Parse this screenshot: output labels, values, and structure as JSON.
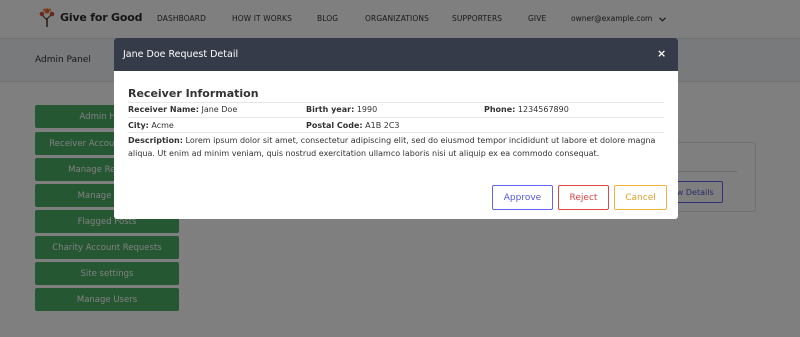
{
  "brand": {
    "name": "Give for Good",
    "logo_icon": "tree-heart-icon"
  },
  "nav": {
    "items": [
      "DASHBOARD",
      "HOW IT WORKS",
      "BLOG",
      "ORGANIZATIONS",
      "SUPPORTERS",
      "GIVE"
    ],
    "user_email": "owner@example.com"
  },
  "admin_panel_title": "Admin Panel",
  "sidebar": {
    "items": [
      "Admin Home",
      "Receiver Account Requests",
      "Manage Receivers",
      "Manage Posts",
      "Flagged Posts",
      "Charity Account Requests",
      "Site settings",
      "Manage Users"
    ]
  },
  "card": {
    "button_label": "View Details"
  },
  "modal": {
    "title": "Jane Doe Request Detail",
    "close_symbol": "×",
    "section_title": "Receiver Information",
    "fields": {
      "receiver_name_label": "Receiver Name:",
      "receiver_name": "Jane Doe",
      "birth_year_label": "Birth year:",
      "birth_year": "1990",
      "phone_label": "Phone:",
      "phone": "1234567890",
      "city_label": "City:",
      "city": "Acme",
      "postal_code_label": "Postal Code:",
      "postal_code": "A1B 2C3",
      "description_label": "Description:",
      "description": "Lorem ipsum dolor sit amet, consectetur adipiscing elit, sed do eiusmod tempor incididunt ut labore et dolore magna aliqua. Ut enim ad minim veniam, quis nostrud exercitation ullamco laboris nisi ut aliquip ex ea commodo consequat."
    },
    "buttons": {
      "approve": "Approve",
      "reject": "Reject",
      "cancel": "Cancel"
    }
  },
  "colors": {
    "accent_green": "#4caf67",
    "modal_header": "#353b48",
    "approve": "#6366f1",
    "reject": "#e04848",
    "cancel": "#f0b33a"
  }
}
